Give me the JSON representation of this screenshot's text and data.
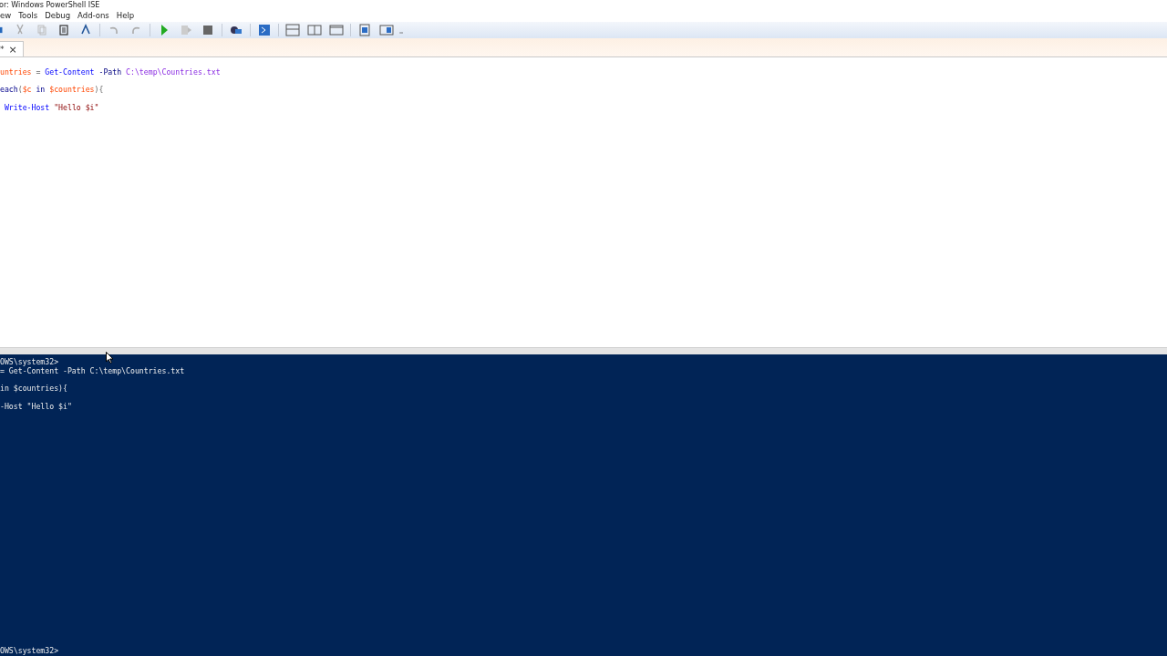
{
  "window": {
    "title": "or: Windows PowerShell ISE"
  },
  "menu": [
    "ew",
    "Tools",
    "Debug",
    "Add-ons",
    "Help"
  ],
  "tabs": [
    {
      "label": "*",
      "close": "×",
      "selected": true
    }
  ],
  "editor": {
    "lines": [
      [
        {
          "kind": "variable",
          "text": "untries"
        },
        {
          "kind": "operator",
          "text": " = "
        },
        {
          "kind": "command",
          "text": "Get-Content"
        },
        {
          "kind": "parameter",
          "text": " -Path"
        },
        {
          "kind": "argument",
          "text": " C:\\temp\\Countries.txt"
        }
      ],
      [
        {
          "kind": "keyword",
          "text": "each"
        },
        {
          "kind": "operator",
          "text": "("
        },
        {
          "kind": "variable",
          "text": "$c"
        },
        {
          "kind": "keyword",
          "text": " in "
        },
        {
          "kind": "variable",
          "text": "$countries"
        },
        {
          "kind": "operator",
          "text": "){"
        }
      ],
      [
        {
          "kind": "command",
          "text": " Write-Host"
        },
        {
          "kind": "string",
          "text": " \"Hello $i\""
        }
      ]
    ]
  },
  "console": {
    "lines": [
      "OWS\\system32>",
      "= Get-Content -Path C:\\temp\\Countries.txt",
      "in $countries){",
      "-Host \"Hello $i\""
    ],
    "prompt": "OWS\\system32>"
  }
}
